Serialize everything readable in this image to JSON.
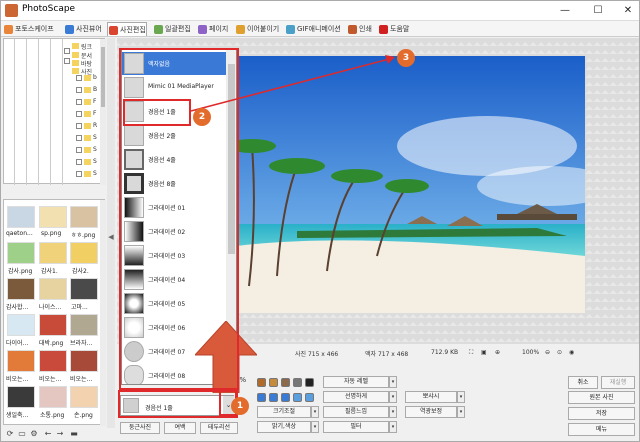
{
  "window": {
    "title": "PhotoScape",
    "minimize": "—",
    "maximize": "☐",
    "close": "✕"
  },
  "tabs": [
    {
      "label": "포토스케이프",
      "color": "#e9853a"
    },
    {
      "label": "사진뷰어",
      "color": "#3a7bd5"
    },
    {
      "label": "사진편집",
      "color": "#d9452f"
    },
    {
      "label": "일괄편집",
      "color": "#6aa84f"
    },
    {
      "label": "페이지",
      "color": "#8e63c7"
    },
    {
      "label": "이어붙이기",
      "color": "#e0a030"
    },
    {
      "label": "GIF애니메이션",
      "color": "#4aa0c8"
    },
    {
      "label": "인쇄",
      "color": "#c05a2e"
    },
    {
      "label": "도움말",
      "color": "#d02020"
    }
  ],
  "tree": {
    "items": [
      "링크",
      "문서",
      "바탕",
      "사진",
      "b",
      "B",
      "F",
      "F",
      "R",
      "S",
      "S",
      "S",
      "S"
    ]
  },
  "thumbnails": [
    {
      "label": "qaeton...",
      "color": "#c9d6e3"
    },
    {
      "label": "sp.png",
      "color": "#f3e0b0"
    },
    {
      "label": "ㅎㅎ.png",
      "color": "#d8c2a2"
    },
    {
      "label": "감사.png",
      "color": "#9fd08a"
    },
    {
      "label": "감사1.",
      "color": "#f0d27a"
    },
    {
      "label": "감사2.",
      "color": "#f2cf62"
    },
    {
      "label": "감사합...",
      "color": "#7a5a3a"
    },
    {
      "label": "나이스...",
      "color": "#e7d3a0"
    },
    {
      "label": "고마...",
      "color": "#4a4a4a"
    },
    {
      "label": "다이어...",
      "color": "#d8e8f2"
    },
    {
      "label": "대박.png",
      "color": "#c84a38"
    },
    {
      "label": "브라자...",
      "color": "#b0a890"
    },
    {
      "label": "비오는...",
      "color": "#e27a3a"
    },
    {
      "label": "비오는...",
      "color": "#c94a3a"
    },
    {
      "label": "비오는...",
      "color": "#a84a3a"
    },
    {
      "label": "생일축...",
      "color": "#3a3a3a"
    },
    {
      "label": "소통.png",
      "color": "#e3c7c0"
    },
    {
      "label": "손.png",
      "color": "#f3d2b0"
    }
  ],
  "frame_list": {
    "items": [
      "액자없음",
      "Mimic 01 MediaPlayer",
      "경음선 1줄",
      "경음선 2줄",
      "경음선 4줄",
      "경음선 8줄",
      "그라데이션 01",
      "그라데이션 02",
      "그라데이션 03",
      "그라데이션 04",
      "그라데이션 05",
      "그라데이션 06",
      "그라데이션 07",
      "그라데이션 08"
    ],
    "selected_index": 0,
    "highlight_index": 2
  },
  "combo": {
    "value": "경음선 1줄",
    "arrow": "⌄"
  },
  "badges": [
    "1",
    "2",
    "3"
  ],
  "status": {
    "photo_size": "사진 715 x 466",
    "frame_size": "액자 717 x 468",
    "file_size": "712.9 KB",
    "zoom": "100%"
  },
  "zoom_percent": "0%",
  "bottom_buttons": {
    "round_photo": "둥근사진",
    "margin": "여백",
    "detail": "테두리선"
  },
  "controls": {
    "auto_level": "자동 레벨",
    "sharpen": "선명하게",
    "film_effect": "필름느낌",
    "filter": "필터",
    "brightness": "밝기,색상",
    "resize": "크기조절",
    "backlight": "뽀샤시",
    "reverse": "역광보정"
  },
  "right_buttons": {
    "undo": "취소",
    "redo": "재실행",
    "original": "원본 사진",
    "save": "저장",
    "menu": "메뉴"
  }
}
